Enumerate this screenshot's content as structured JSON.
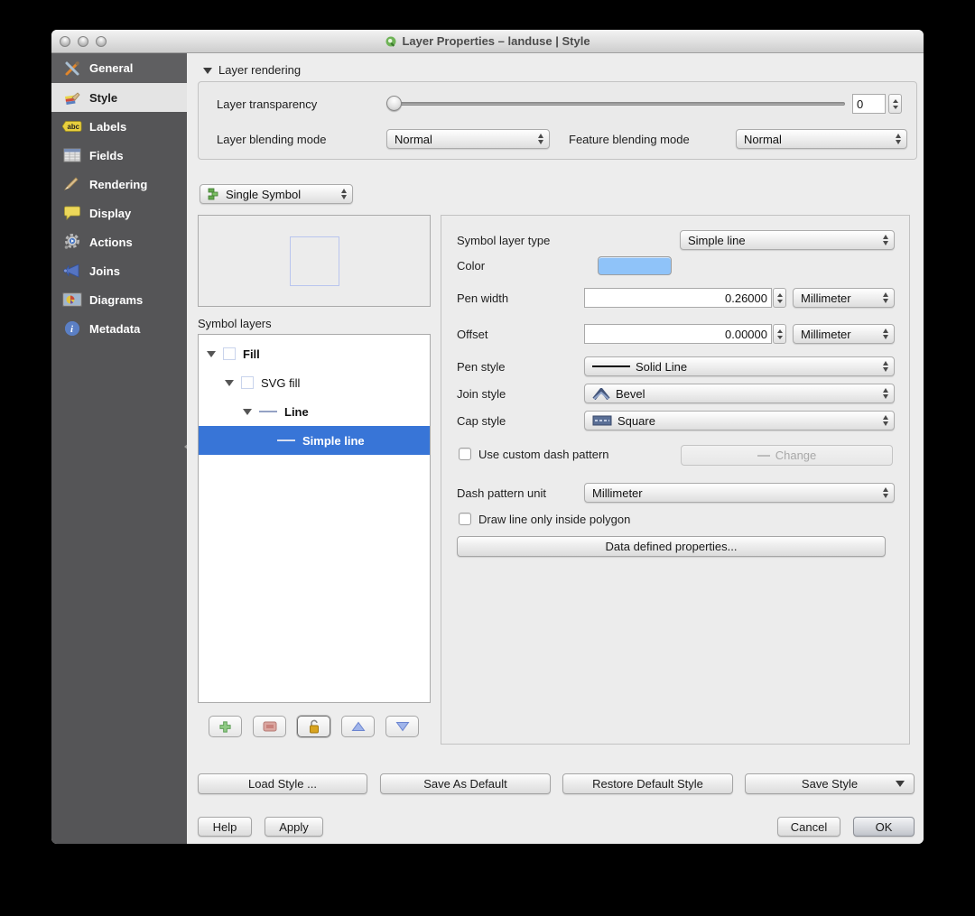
{
  "window": {
    "title": "Layer Properties – landuse | Style",
    "app_icon": "qgis-icon"
  },
  "sidebar": {
    "items": [
      {
        "label": "General",
        "icon": "tools-icon"
      },
      {
        "label": "Style",
        "icon": "style-brush-icon",
        "selected": true
      },
      {
        "label": "Labels",
        "icon": "abc-label-icon"
      },
      {
        "label": "Fields",
        "icon": "table-icon"
      },
      {
        "label": "Rendering",
        "icon": "brush-icon"
      },
      {
        "label": "Display",
        "icon": "speech-bubble-icon"
      },
      {
        "label": "Actions",
        "icon": "gear-action-icon"
      },
      {
        "label": "Joins",
        "icon": "join-arrow-icon"
      },
      {
        "label": "Diagrams",
        "icon": "diagram-icon"
      },
      {
        "label": "Metadata",
        "icon": "info-icon"
      }
    ]
  },
  "layer_rendering": {
    "header": "Layer rendering",
    "transparency_label": "Layer transparency",
    "transparency_value": "0",
    "transparency_percent": 0,
    "layer_blending_label": "Layer blending mode",
    "layer_blending_value": "Normal",
    "feature_blending_label": "Feature blending mode",
    "feature_blending_value": "Normal"
  },
  "symbol": {
    "renderer_value": "Single Symbol",
    "symbol_layers_label": "Symbol layers",
    "tree": {
      "rows": [
        {
          "label": "Fill",
          "icon": "fill-swatch",
          "bold": true,
          "selected": false
        },
        {
          "label": "SVG fill",
          "icon": "fill-swatch",
          "bold": false,
          "selected": false
        },
        {
          "label": "Line",
          "icon": "line-swatch",
          "bold": true,
          "selected": false
        },
        {
          "label": "Simple line",
          "icon": "line-swatch",
          "bold": true,
          "selected": true
        }
      ]
    }
  },
  "properties": {
    "symbol_layer_type_label": "Symbol layer type",
    "symbol_layer_type_value": "Simple line",
    "color_label": "Color",
    "color_value": "#8fc3f9",
    "pen_width_label": "Pen width",
    "pen_width_value": "0.26000",
    "pen_width_unit": "Millimeter",
    "offset_label": "Offset",
    "offset_value": "0.00000",
    "offset_unit": "Millimeter",
    "pen_style_label": "Pen style",
    "pen_style_value": "Solid Line",
    "join_style_label": "Join style",
    "join_style_value": "Bevel",
    "cap_style_label": "Cap style",
    "cap_style_value": "Square",
    "custom_dash_label": "Use custom dash pattern",
    "custom_dash_checked": false,
    "change_button": "Change",
    "dash_unit_label": "Dash pattern unit",
    "dash_unit_value": "Millimeter",
    "draw_inside_label": "Draw line only inside polygon",
    "draw_inside_checked": false,
    "data_defined_button": "Data defined properties..."
  },
  "footer": {
    "load_style": "Load Style ...",
    "save_as_default": "Save As Default",
    "restore_default": "Restore Default Style",
    "save_style": "Save Style",
    "help": "Help",
    "apply": "Apply",
    "cancel": "Cancel",
    "ok": "OK"
  }
}
